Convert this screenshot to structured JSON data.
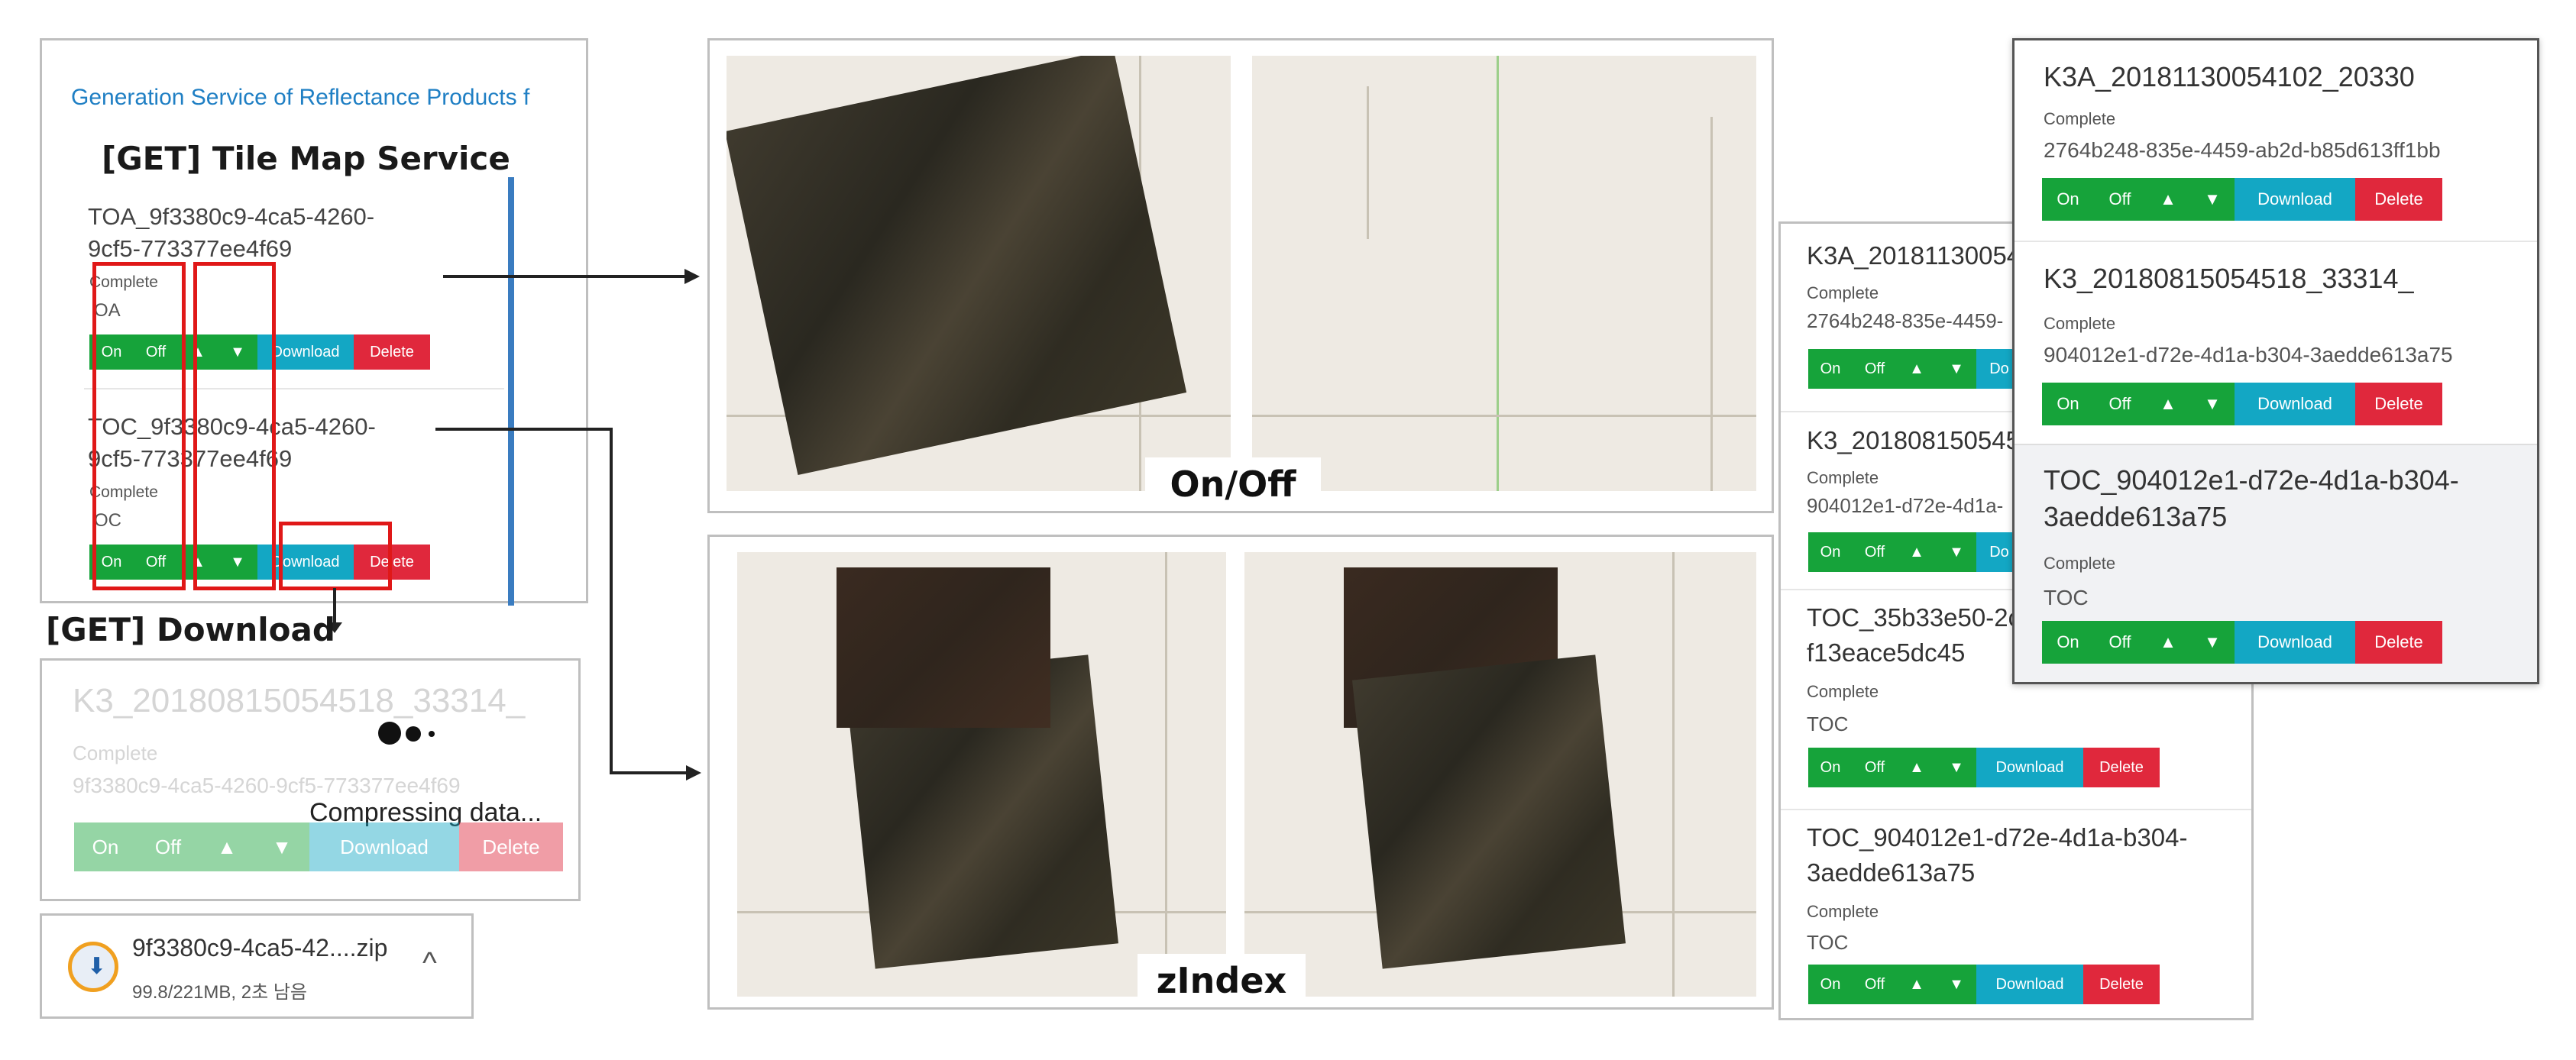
{
  "left_panel": {
    "service_header": "Generation Service of Reflectance Products f",
    "label_tms": "[GET] Tile Map Service",
    "items": [
      {
        "name": "TOA_9f3380c9-4ca5-4260-9cf5-773377ee4f69",
        "status": "Complete",
        "type": "OA",
        "buttons": {
          "on": "On",
          "off": "Off",
          "up": "▲",
          "down": "▼",
          "download": "Download",
          "delete": "Delete"
        }
      },
      {
        "name": "TOC_9f3380c9-4ca5-4260-9cf5-773377ee4f69",
        "status": "Complete",
        "type": "OC",
        "buttons": {
          "on": "On",
          "off": "Off",
          "up": "▲",
          "down": "▼",
          "download": "Download",
          "delete": "Delete"
        }
      }
    ]
  },
  "download_label": "[GET] Download",
  "download_card": {
    "title": "K3_20180815054518_33314_",
    "status": "Complete",
    "id": "9f3380c9-4ca5-4260-9cf5-773377ee4f69",
    "overlay_text": "Compressing data...",
    "buttons": {
      "on": "On",
      "off": "Off",
      "up": "▲",
      "down": "▼",
      "download": "Download",
      "delete": "Delete"
    }
  },
  "download_bar": {
    "filename": "9f3380c9-4ca5-42....zip",
    "progress_text": "99.8/221MB, 2초 남음",
    "icon": "download-progress-icon",
    "chevron": "^"
  },
  "captions": {
    "on_off": "On/Off",
    "zindex": "zIndex"
  },
  "right_panel_back": {
    "items": [
      {
        "title": "K3A_20181130054",
        "status": "Complete",
        "id": "2764b248-835e-4459-",
        "buttons": {
          "on": "On",
          "off": "Off",
          "up": "▲",
          "down": "▼",
          "download": "Do"
        }
      },
      {
        "title": "K3_201808150545",
        "status": "Complete",
        "id": "904012e1-d72e-4d1a-",
        "buttons": {
          "on": "On",
          "off": "Off",
          "up": "▲",
          "down": "▼",
          "download": "Do"
        }
      },
      {
        "title": "TOC_35b33e50-2c",
        "title2": "f13eace5dc45",
        "status": "Complete",
        "type": "TOC",
        "buttons": {
          "on": "On",
          "off": "Off",
          "up": "▲",
          "down": "▼",
          "download": "Download",
          "delete": "Delete"
        }
      },
      {
        "title": "TOC_904012e1-d72e-4d1a-b304-",
        "title2": "3aedde613a75",
        "status": "Complete",
        "type": "TOC",
        "buttons": {
          "on": "On",
          "off": "Off",
          "up": "▲",
          "down": "▼",
          "download": "Download",
          "delete": "Delete"
        }
      }
    ]
  },
  "right_panel_front": {
    "items": [
      {
        "title": "K3A_20181130054102_20330",
        "status": "Complete",
        "id": "2764b248-835e-4459-ab2d-b85d613ff1bb",
        "buttons": {
          "on": "On",
          "off": "Off",
          "up": "▲",
          "down": "▼",
          "download": "Download",
          "delete": "Delete"
        }
      },
      {
        "title": "K3_20180815054518_33314_",
        "status": "Complete",
        "id": "904012e1-d72e-4d1a-b304-3aedde613a75",
        "buttons": {
          "on": "On",
          "off": "Off",
          "up": "▲",
          "down": "▼",
          "download": "Download",
          "delete": "Delete"
        }
      },
      {
        "title": "TOC_904012e1-d72e-4d1a-b304-",
        "title2": "3aedde613a75",
        "status": "Complete",
        "type": "TOC",
        "buttons": {
          "on": "On",
          "off": "Off",
          "up": "▲",
          "down": "▼",
          "download": "Download",
          "delete": "Delete"
        }
      }
    ]
  },
  "colors": {
    "green": "#16a33a",
    "cyan": "#13a7c4",
    "red": "#e0283c",
    "highlight_red": "#e01818",
    "link_blue": "#1f7fc4"
  }
}
